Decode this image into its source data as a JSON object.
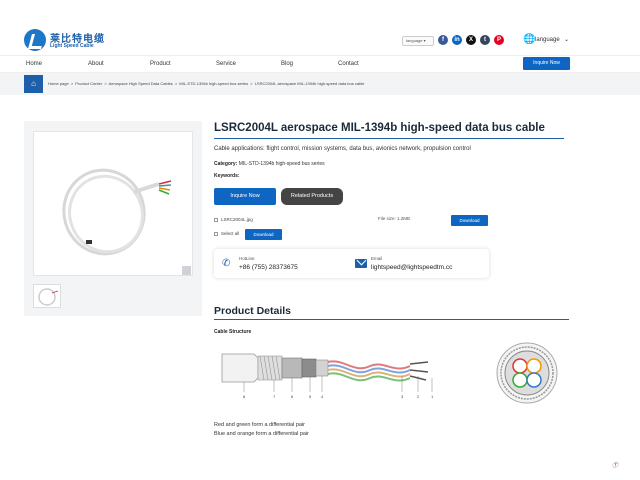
{
  "brand": {
    "name_cn": "莱比特电缆",
    "name_en": "Light Speed Cable"
  },
  "header": {
    "language_select": "language",
    "language_label": "language",
    "social": [
      {
        "name": "facebook",
        "glyph": "f",
        "color": "#3b5998"
      },
      {
        "name": "linkedin",
        "glyph": "in",
        "color": "#0a66c2"
      },
      {
        "name": "x",
        "glyph": "X",
        "color": "#111111"
      },
      {
        "name": "tumblr",
        "glyph": "t",
        "color": "#35465c"
      },
      {
        "name": "pinterest",
        "glyph": "P",
        "color": "#e60023"
      }
    ]
  },
  "nav": {
    "items": [
      "Home",
      "About",
      "Product",
      "Service",
      "Blog",
      "Contact"
    ],
    "inquire_now": "Inquire Now"
  },
  "breadcrumb": {
    "items": [
      "Home page",
      ">",
      "Product Center",
      ">",
      "Aerospace High Speed Data Cables",
      ">",
      "MIL-STD-1394b high-speed bus series",
      ">",
      "LSRC2004L aerospace MIL-1394b high-speed data bus cable"
    ]
  },
  "product": {
    "title": "LSRC2004L aerospace MIL-1394b high-speed data bus cable",
    "applications": "Cable applications: flight control, mission systems, data bus, avionics network, propulsion control",
    "category_label": "Category:",
    "category_value": "MIL-STD-1394b high-speed bus series",
    "keywords_label": "Keywords:",
    "inquire_btn": "Inquire Now",
    "related_btn": "Related Products",
    "file_name": "LSRC2004L.jpg",
    "file_size": "File size: 1.2MB",
    "download_label": "Download",
    "select_all": "Select all",
    "download_all_label": "Download"
  },
  "contact": {
    "hotline_label": "HotLine",
    "hotline_value": "+86  (755)  28373675",
    "email_label": "Email",
    "email_value": "lightspeed@lightspeedtm.cc"
  },
  "details": {
    "heading": "Product Details",
    "structure_label": "Cable Structure",
    "structure_numbers": [
      "8",
      "7",
      "6",
      "5",
      "4",
      "3",
      "2",
      "1"
    ],
    "pair_note_1": "Red and green form a differential pair",
    "pair_note_2": "Blue and orange form a differential pair"
  },
  "watermark": "Ⓣ"
}
